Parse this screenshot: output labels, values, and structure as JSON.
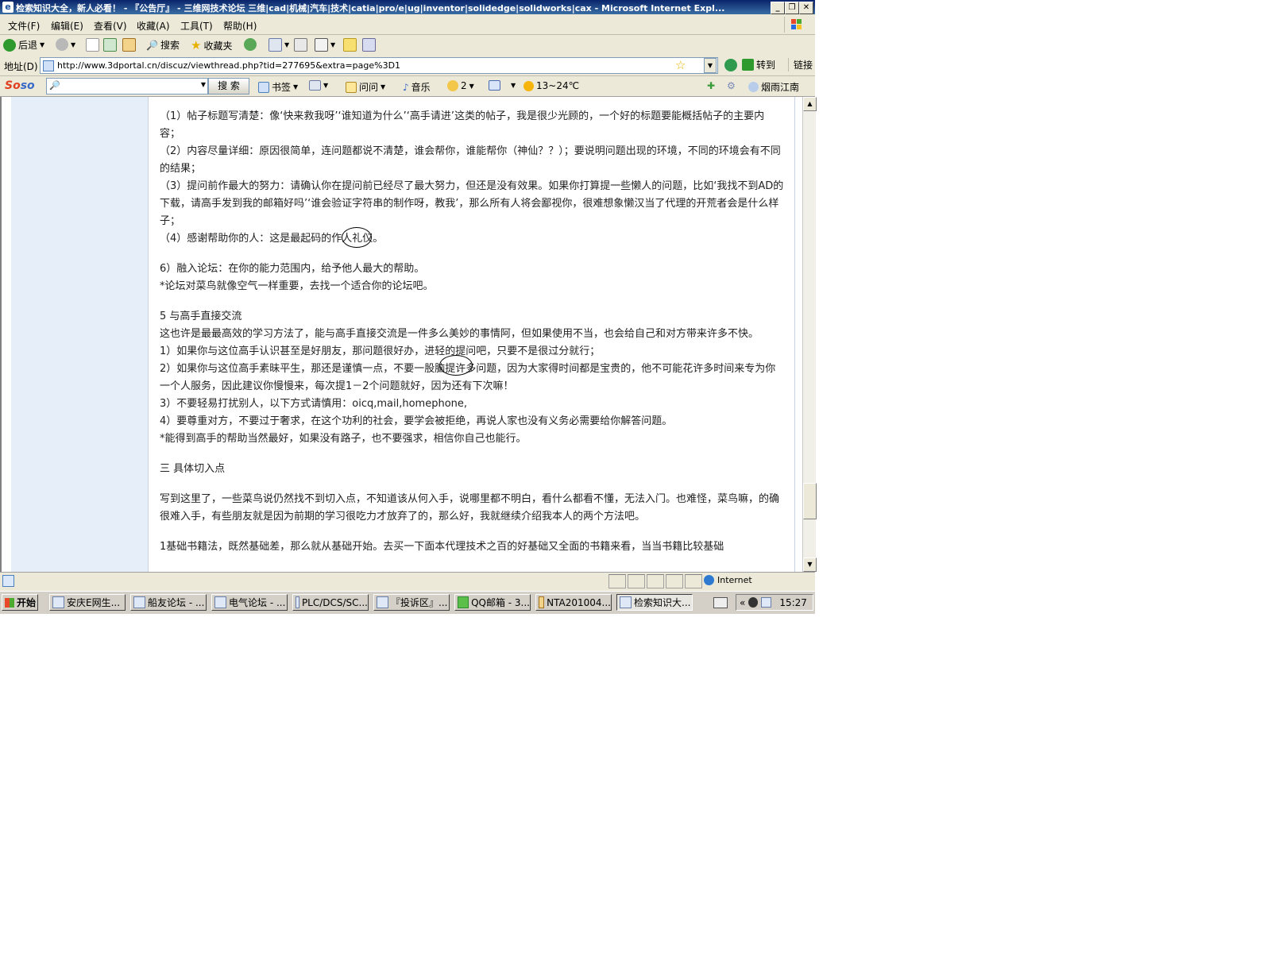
{
  "window": {
    "title": "检索知识大全，新人必看！ - 『公告厅』 - 三维网技术论坛 三维|cad|机械|汽车|技术|catia|pro/e|ug|inventor|solidedge|solidworks|cax - Microsoft Internet Expl...",
    "min_label": "_",
    "max_label": "❐",
    "close_label": "✕"
  },
  "menu": [
    "文件(F)",
    "编辑(E)",
    "查看(V)",
    "收藏(A)",
    "工具(T)",
    "帮助(H)"
  ],
  "toolbar": {
    "back": "后退",
    "search": "搜索",
    "favorites": "收藏夹"
  },
  "address": {
    "label": "地址(D)",
    "url": "http://www.3dportal.cn/discuz/viewthread.php?tid=277695&extra=page%3D1",
    "go": "转到",
    "links": "链接"
  },
  "soso": {
    "logo_a": "So",
    "logo_b": "so",
    "search_button": "搜 索",
    "bookmarks": "书签",
    "ask": "问问",
    "music": "音乐",
    "count": "2",
    "weather": "13~24℃",
    "user": "烟雨江南"
  },
  "content": {
    "p1": "（1）帖子标题写清楚：像‘快来救我呀’‘谁知道为什么’‘高手请进’这类的帖子，我是很少光顾的，一个好的标题要能概括帖子的主要内容；",
    "p2": "（2）内容尽量详细：原因很简单，连问题都说不清楚，谁会帮你，谁能帮你（神仙？？）；要说明问题出现的环境，不同的环境会有不同的结果；",
    "p3": "（3）提问前作最大的努力：请确认你在提问前已经尽了最大努力，但还是没有效果。如果你打算提一些懒人的问题，比如‘我找不到AD的下载，请高手发到我的邮箱好吗’‘谁会验证字符串的制作呀，教我’，那么所有人将会鄙视你，很难想象懒汉当了代理的开荒者会是什么样子；",
    "p4": "（4）感谢帮助你的人：这是最起码的作人礼仪。",
    "p5": "6）融入论坛：在你的能力范围内，给予他人最大的帮助。",
    "p6": "*论坛对菜鸟就像空气一样重要，去找一个适合你的论坛吧。",
    "h5": "5 与高手直接交流",
    "p7": "这也许是最最高效的学习方法了，能与高手直接交流是一件多么美妙的事情阿，但如果使用不当，也会给自己和对方带来许多不快。",
    "p8": "1）如果你与这位高手认识甚至是好朋友，那问题很好办，进轻的提问吧，只要不是很过分就行；",
    "p9": "2）如果你与这位高手素昧平生，那还是谨慎一点，不要一股脑提许多问题，因为大家得时间都是宝贵的，他不可能花许多时间来专为你一个人服务，因此建议你慢慢来，每次提1－2个问题就好，因为还有下次嘛！",
    "p10": "3）不要轻易打扰别人，以下方式请慎用：oicq,mail,homephone,",
    "p11": "4）要尊重对方，不要过于奢求，在这个功利的社会，要学会被拒绝，再说人家也没有义务必需要给你解答问题。",
    "p12": "*能得到高手的帮助当然最好，如果没有路子，也不要强求，相信你自己也能行。",
    "h3": "三 具体切入点",
    "p13": "写到这里了，一些菜鸟说仍然找不到切入点，不知道该从何入手，说哪里都不明白，看什么都看不懂，无法入门。也难怪，菜鸟嘛，的确很难入手，有些朋友就是因为前期的学习很吃力才放弃了的，那么好，我就继续介绍我本人的两个方法吧。",
    "p14": "1基础书籍法，既然基础差，那么就从基础开始。去买一下面本代理技术之百的好基础又全面的书籍来看，当当书籍比较基础"
  },
  "status": {
    "zone": "Internet"
  },
  "taskbar": {
    "start": "开始",
    "tasks": [
      "安庆E网生...",
      "船友论坛 - ...",
      "电气论坛 - ...",
      "PLC/DCS/SC...",
      "『投诉区』...",
      "QQ邮箱 - 3...",
      "NTA201004...",
      "检索知识大..."
    ],
    "tray_arrow": "«",
    "clock": "15:27"
  },
  "colors": {
    "titlebar": "#0a246a",
    "sidebar": "#e6eef9",
    "chrome": "#ece9d8"
  }
}
